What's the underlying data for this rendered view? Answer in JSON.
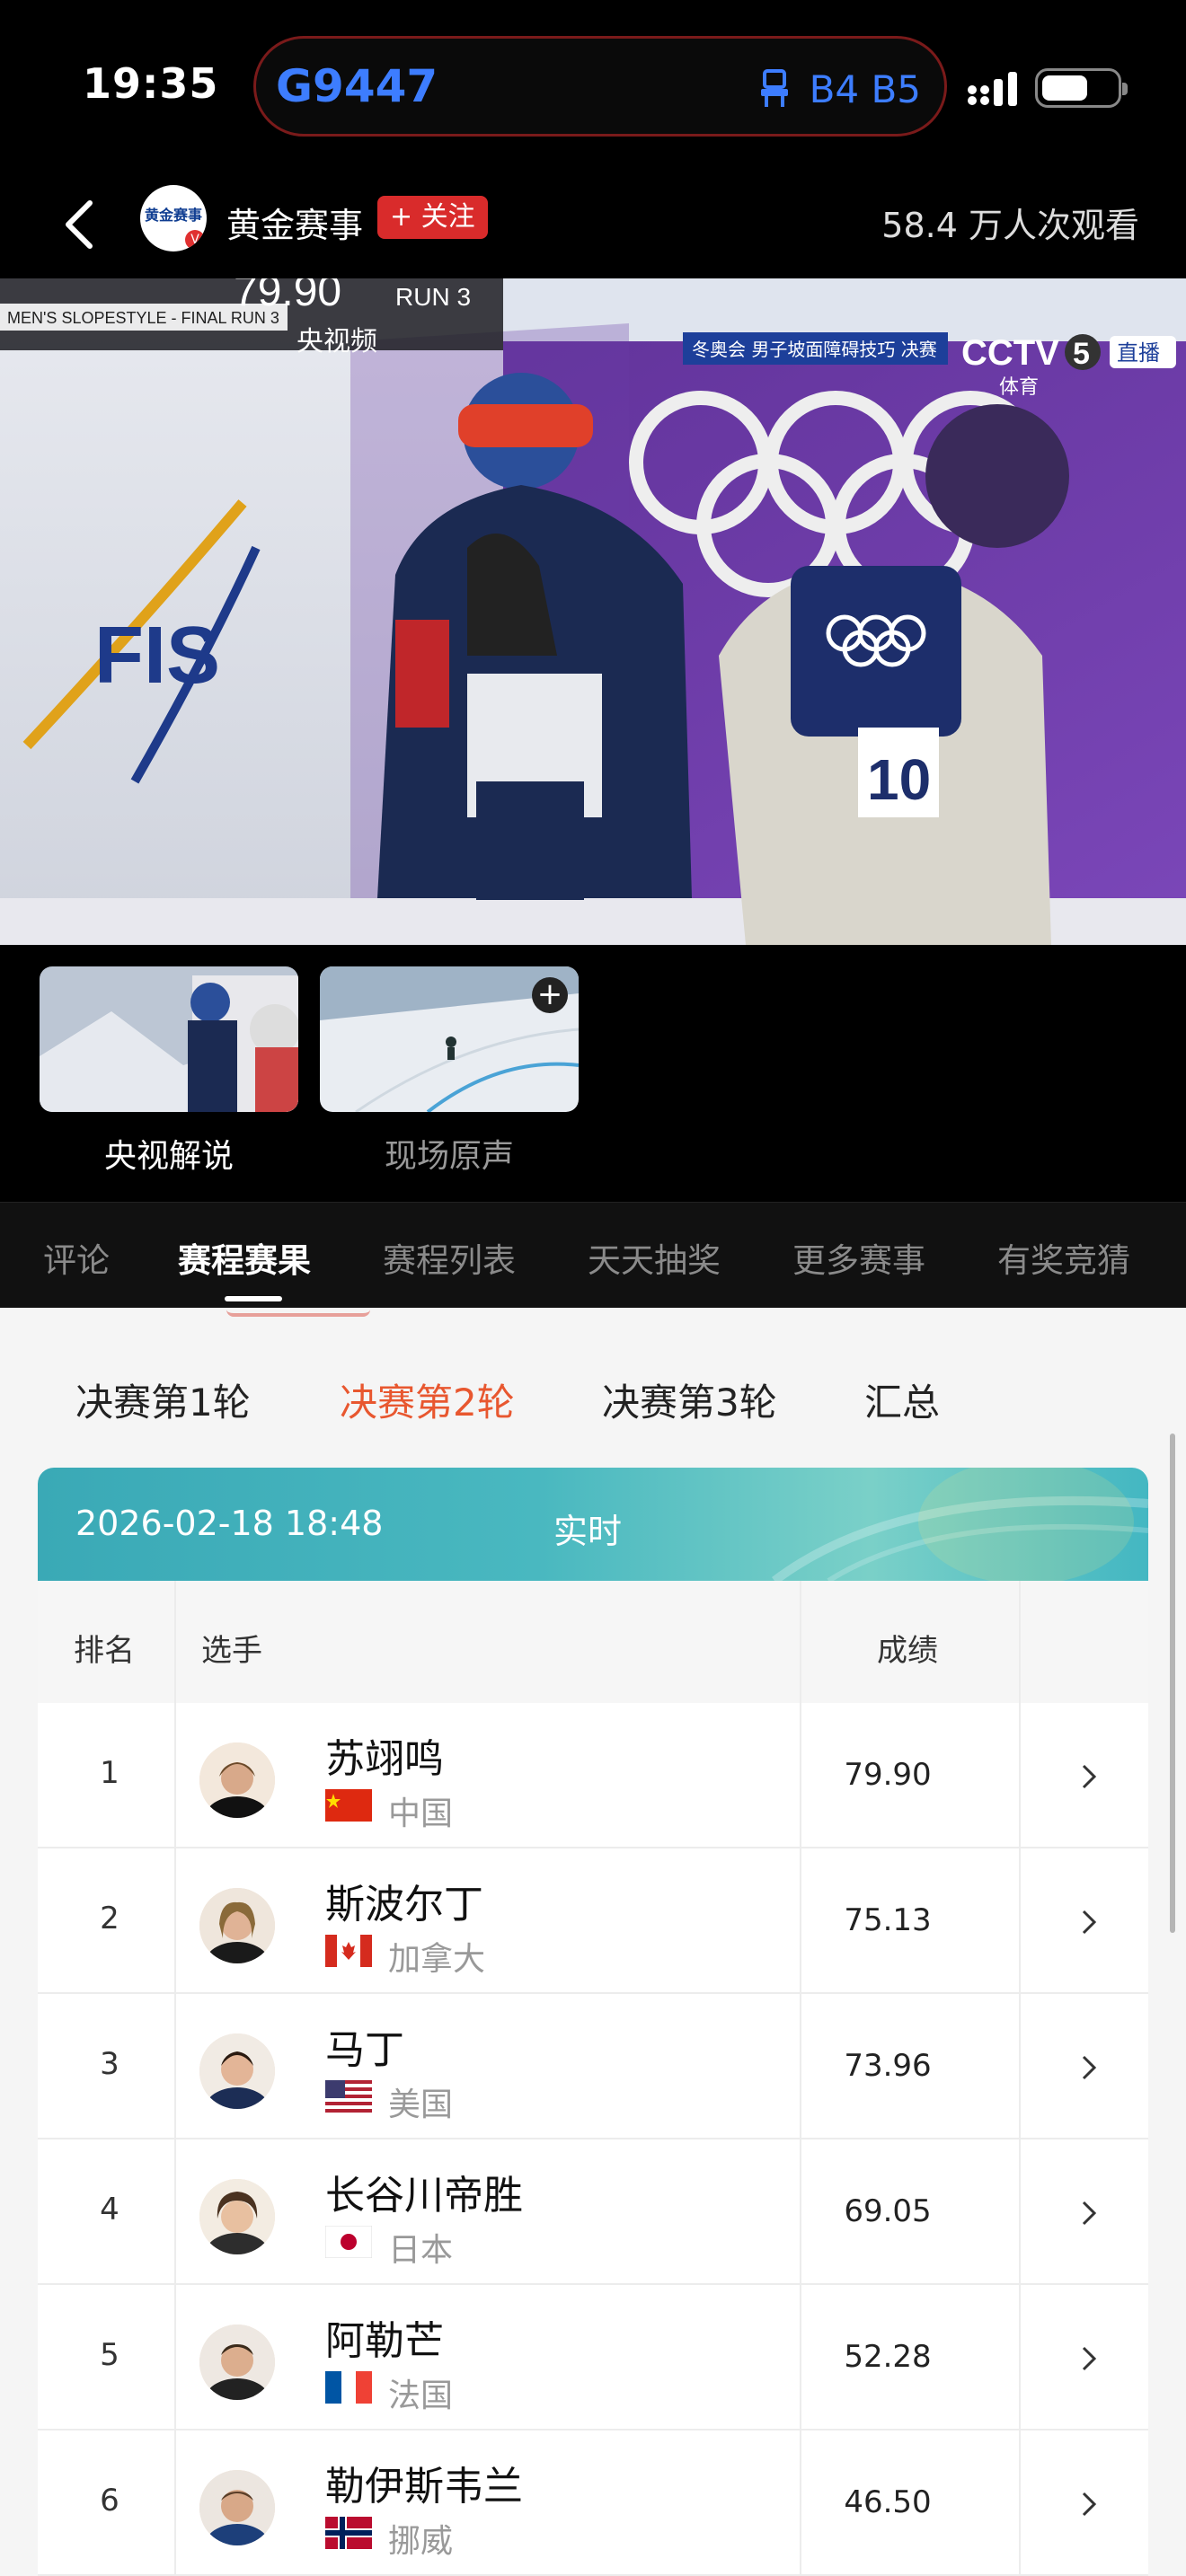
{
  "status_bar": {
    "time": "19:35",
    "train_number": "G9447",
    "carriage": "B4 B5"
  },
  "header": {
    "channel_name": "黄金赛事",
    "logo_text": "黄金赛事",
    "follow_label": "+ 关注",
    "viewers": "58.4 万人次观看"
  },
  "video": {
    "overlay_event": "MEN'S SLOPESTYLE - FINAL RUN 3",
    "overlay_score": "79.90",
    "overlay_run": "RUN 3",
    "watermark": "央视频",
    "broadcast_caption": "冬奥会  男子坡面障碍技巧 决赛",
    "channel_logo": "CCTV",
    "channel_number": "5",
    "channel_sub": "体育",
    "live_label": "直播",
    "bib_number": "10",
    "fis_text": "FIS"
  },
  "audio_options": [
    {
      "label": "央视解说",
      "selected": true
    },
    {
      "label": "现场原声",
      "selected": false
    }
  ],
  "tabs": [
    "评论",
    "赛程赛果",
    "赛程列表",
    "天天抽奖",
    "更多赛事",
    "有奖竞猜"
  ],
  "active_tab": "赛程赛果",
  "rounds": [
    "决赛第1轮",
    "决赛第2轮",
    "决赛第3轮",
    "汇总"
  ],
  "active_round": "决赛第2轮",
  "results": {
    "datetime": "2026-02-18 18:48",
    "live_label": "实时",
    "columns": {
      "rank": "排名",
      "player": "选手",
      "score": "成绩"
    },
    "rows": [
      {
        "rank": "1",
        "name": "苏翊鸣",
        "country": "中国",
        "flag": "china",
        "score": "79.90"
      },
      {
        "rank": "2",
        "name": "斯波尔丁",
        "country": "加拿大",
        "flag": "canada",
        "score": "75.13"
      },
      {
        "rank": "3",
        "name": "马丁",
        "country": "美国",
        "flag": "usa",
        "score": "73.96"
      },
      {
        "rank": "4",
        "name": "长谷川帝胜",
        "country": "日本",
        "flag": "japan",
        "score": "69.05"
      },
      {
        "rank": "5",
        "name": "阿勒芒",
        "country": "法国",
        "flag": "france",
        "score": "52.28"
      },
      {
        "rank": "6",
        "name": "勒伊斯韦兰",
        "country": "挪威",
        "flag": "norway",
        "score": "46.50"
      }
    ]
  },
  "colors": {
    "accent_orange": "#e8572f",
    "follow_red": "#d92b2b",
    "train_blue": "#3d7dff",
    "banner_teal": "#43b7c2"
  }
}
